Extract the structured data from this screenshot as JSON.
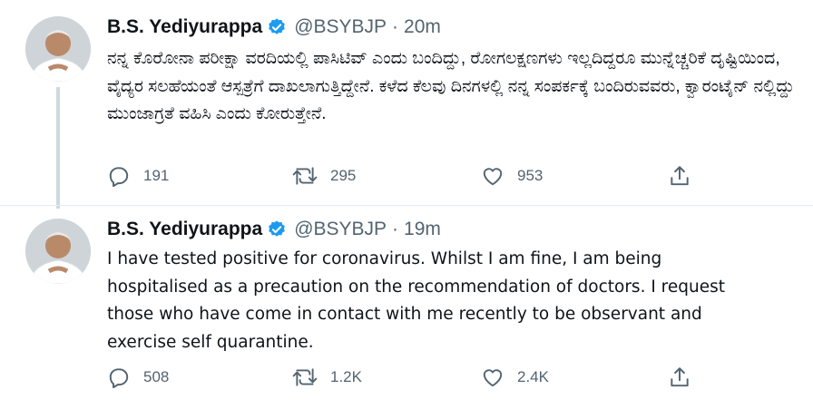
{
  "tweets": [
    {
      "author": {
        "name": "B.S. Yediyurappa",
        "handle": "@BSYBJP",
        "verified": true
      },
      "separator": "·",
      "time": "20m",
      "text": "ನನ್ನ ಕೊರೋನಾ ಪರೀಕ್ಷಾ ವರದಿಯಲ್ಲಿ ಪಾಸಿಟಿವ್ ಎಂದು ಬಂದಿದ್ದು, ರೋಗಲಕ್ಷಣಗಳು ಇಲ್ಲದಿದ್ದರೂ ಮುನ್ನೆಚ್ಚರಿಕೆ ದೃಷ್ಟಿಯಿಂದ, ವೈದ್ಯರ ಸಲಹೆಯಂತೆ ಆಸ್ಪತ್ರೆಗೆ ದಾಖಲಾಗುತ್ತಿದ್ದೇನೆ. ಕಳೆದ ಕೆಲವು ದಿನಗಳಲ್ಲಿ ನನ್ನ ಸಂಪರ್ಕಕ್ಕೆ ಬಂದಿರುವವರು, ಕ್ವಾರಂಟೈನ್ ನಲ್ಲಿದ್ದು ಮುಂಜಾಗ್ರತೆ ವಹಿಸಿ ಎಂದು ಕೋರುತ್ತೇನೆ.",
      "stats": {
        "replies": "191",
        "retweets": "295",
        "likes": "953"
      }
    },
    {
      "author": {
        "name": "B.S. Yediyurappa",
        "handle": "@BSYBJP",
        "verified": true
      },
      "separator": "·",
      "time": "19m",
      "text": "I have tested positive for coronavirus. Whilst I am fine, I am being\nhospitalised as a precaution on the recommendation of doctors. I request\nthose who have come in contact with me recently to be observant and\nexercise self quarantine.",
      "stats": {
        "replies": "508",
        "retweets": "1.2K",
        "likes": "2.4K"
      }
    }
  ],
  "colors": {
    "accent": "#1d9bf0",
    "muted": "#536471",
    "text": "#0f1419",
    "thread_line": "#cfd9de"
  },
  "icons": [
    "avatar-photo",
    "verified-badge-icon",
    "reply-icon",
    "retweet-icon",
    "like-icon",
    "share-icon"
  ]
}
